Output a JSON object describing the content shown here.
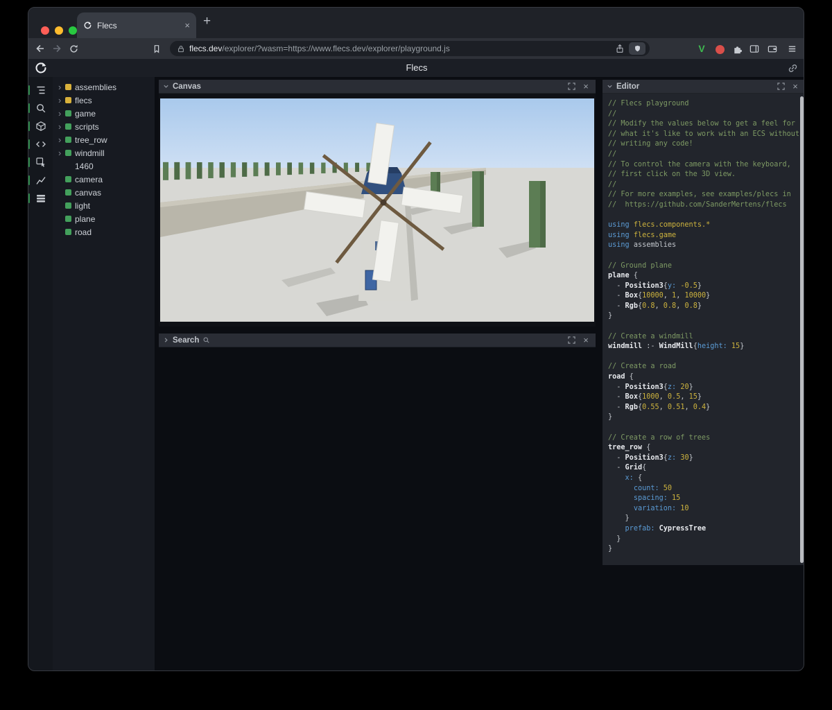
{
  "browser": {
    "traffic_lights": {
      "close": "#ff5f57",
      "minimize": "#febc2e",
      "maximize": "#28c840"
    },
    "tab": {
      "title": "Flecs",
      "close_label": "×",
      "new_tab_label": "+"
    },
    "address": {
      "domain": "flecs.dev",
      "path": "/explorer/?wasm=https://www.flecs.dev/explorer/playground.js"
    },
    "extensions": {
      "v_label": "V"
    }
  },
  "app": {
    "title": "Flecs",
    "sidebar_icons": [
      {
        "name": "tree-icon"
      },
      {
        "name": "search-icon"
      },
      {
        "name": "entities-icon"
      },
      {
        "name": "code-icon"
      },
      {
        "name": "inspector-icon"
      },
      {
        "name": "stats-icon"
      },
      {
        "name": "memory-icon"
      }
    ],
    "tree": {
      "expand_glyph": "›",
      "items": [
        {
          "label": "assemblies",
          "color": "#d9b13b",
          "expandable": true
        },
        {
          "label": "flecs",
          "color": "#d9b13b",
          "expandable": true
        },
        {
          "label": "game",
          "color": "#43a05c",
          "expandable": true
        },
        {
          "label": "scripts",
          "color": "#43a05c",
          "expandable": true
        },
        {
          "label": "tree_row",
          "color": "#43a05c",
          "expandable": true
        },
        {
          "label": "windmill",
          "color": "#43a05c",
          "expandable": true
        },
        {
          "label": "1460",
          "color": null,
          "expandable": false
        },
        {
          "label": "camera",
          "color": "#43a05c",
          "expandable": false
        },
        {
          "label": "canvas",
          "color": "#43a05c",
          "expandable": false
        },
        {
          "label": "light",
          "color": "#43a05c",
          "expandable": false
        },
        {
          "label": "plane",
          "color": "#43a05c",
          "expandable": false
        },
        {
          "label": "road",
          "color": "#43a05c",
          "expandable": false
        }
      ]
    },
    "panels": {
      "close_label": "×",
      "canvas": {
        "title": "Canvas"
      },
      "search": {
        "title": "Search"
      },
      "editor": {
        "title": "Editor"
      }
    },
    "editor": {
      "colors": {
        "comment": "#7e9a64",
        "keyword": "#5b9bd5",
        "module": "#cdb33e",
        "type": "#e8eaee",
        "property": "#5b9bd5",
        "number": "#cdb33e",
        "default": "#c3c7cd"
      },
      "lines": [
        [
          [
            "c",
            "// Flecs playground"
          ]
        ],
        [
          [
            "c",
            "//"
          ]
        ],
        [
          [
            "c",
            "// Modify the values below to get a feel for"
          ]
        ],
        [
          [
            "c",
            "// what it's like to work with an ECS without"
          ]
        ],
        [
          [
            "c",
            "// writing any code!"
          ]
        ],
        [
          [
            "c",
            "//"
          ]
        ],
        [
          [
            "c",
            "// To control the camera with the keyboard,"
          ]
        ],
        [
          [
            "c",
            "// first click on the 3D view."
          ]
        ],
        [
          [
            "c",
            "//"
          ]
        ],
        [
          [
            "c",
            "// For more examples, see examples/plecs in"
          ]
        ],
        [
          [
            "c",
            "//  https://github.com/SanderMertens/flecs"
          ]
        ],
        [],
        [
          [
            "k",
            "using "
          ],
          [
            "m",
            "flecs.components.*"
          ]
        ],
        [
          [
            "k",
            "using "
          ],
          [
            "m",
            "flecs.game"
          ]
        ],
        [
          [
            "k",
            "using "
          ],
          [
            "d",
            "assemblies"
          ]
        ],
        [],
        [
          [
            "c",
            "// Ground plane"
          ]
        ],
        [
          [
            "t",
            "plane"
          ],
          [
            "d",
            " {"
          ]
        ],
        [
          [
            "d",
            "  - "
          ],
          [
            "t",
            "Position3"
          ],
          [
            "d",
            "{"
          ],
          [
            "p",
            "y:"
          ],
          [
            "d",
            " "
          ],
          [
            "n",
            "-0.5"
          ],
          [
            "d",
            "}"
          ]
        ],
        [
          [
            "d",
            "  - "
          ],
          [
            "t",
            "Box"
          ],
          [
            "d",
            "{"
          ],
          [
            "n",
            "10000"
          ],
          [
            "d",
            ", "
          ],
          [
            "n",
            "1"
          ],
          [
            "d",
            ", "
          ],
          [
            "n",
            "10000"
          ],
          [
            "d",
            "}"
          ]
        ],
        [
          [
            "d",
            "  - "
          ],
          [
            "t",
            "Rgb"
          ],
          [
            "d",
            "{"
          ],
          [
            "n",
            "0.8"
          ],
          [
            "d",
            ", "
          ],
          [
            "n",
            "0.8"
          ],
          [
            "d",
            ", "
          ],
          [
            "n",
            "0.8"
          ],
          [
            "d",
            "}"
          ]
        ],
        [
          [
            "d",
            "}"
          ]
        ],
        [],
        [
          [
            "c",
            "// Create a windmill"
          ]
        ],
        [
          [
            "t",
            "windmill"
          ],
          [
            "d",
            " :- "
          ],
          [
            "t",
            "WindMill"
          ],
          [
            "d",
            "{"
          ],
          [
            "p",
            "height:"
          ],
          [
            "d",
            " "
          ],
          [
            "n",
            "15"
          ],
          [
            "d",
            "}"
          ]
        ],
        [],
        [
          [
            "c",
            "// Create a road"
          ]
        ],
        [
          [
            "t",
            "road"
          ],
          [
            "d",
            " {"
          ]
        ],
        [
          [
            "d",
            "  - "
          ],
          [
            "t",
            "Position3"
          ],
          [
            "d",
            "{"
          ],
          [
            "p",
            "z:"
          ],
          [
            "d",
            " "
          ],
          [
            "n",
            "20"
          ],
          [
            "d",
            "}"
          ]
        ],
        [
          [
            "d",
            "  - "
          ],
          [
            "t",
            "Box"
          ],
          [
            "d",
            "{"
          ],
          [
            "n",
            "1000"
          ],
          [
            "d",
            ", "
          ],
          [
            "n",
            "0.5"
          ],
          [
            "d",
            ", "
          ],
          [
            "n",
            "15"
          ],
          [
            "d",
            "}"
          ]
        ],
        [
          [
            "d",
            "  - "
          ],
          [
            "t",
            "Rgb"
          ],
          [
            "d",
            "{"
          ],
          [
            "n",
            "0.55"
          ],
          [
            "d",
            ", "
          ],
          [
            "n",
            "0.51"
          ],
          [
            "d",
            ", "
          ],
          [
            "n",
            "0.4"
          ],
          [
            "d",
            "}"
          ]
        ],
        [
          [
            "d",
            "}"
          ]
        ],
        [],
        [
          [
            "c",
            "// Create a row of trees"
          ]
        ],
        [
          [
            "t",
            "tree_row"
          ],
          [
            "d",
            " {"
          ]
        ],
        [
          [
            "d",
            "  - "
          ],
          [
            "t",
            "Position3"
          ],
          [
            "d",
            "{"
          ],
          [
            "p",
            "z:"
          ],
          [
            "d",
            " "
          ],
          [
            "n",
            "30"
          ],
          [
            "d",
            "}"
          ]
        ],
        [
          [
            "d",
            "  - "
          ],
          [
            "t",
            "Grid"
          ],
          [
            "d",
            "{"
          ]
        ],
        [
          [
            "d",
            "    "
          ],
          [
            "p",
            "x:"
          ],
          [
            "d",
            " {"
          ]
        ],
        [
          [
            "d",
            "      "
          ],
          [
            "p",
            "count:"
          ],
          [
            "d",
            " "
          ],
          [
            "n",
            "50"
          ]
        ],
        [
          [
            "d",
            "      "
          ],
          [
            "p",
            "spacing:"
          ],
          [
            "d",
            " "
          ],
          [
            "n",
            "15"
          ]
        ],
        [
          [
            "d",
            "      "
          ],
          [
            "p",
            "variation:"
          ],
          [
            "d",
            " "
          ],
          [
            "n",
            "10"
          ]
        ],
        [
          [
            "d",
            "    }"
          ]
        ],
        [
          [
            "d",
            "    "
          ],
          [
            "p",
            "prefab:"
          ],
          [
            "d",
            " "
          ],
          [
            "t",
            "CypressTree"
          ]
        ],
        [
          [
            "d",
            "  }"
          ]
        ],
        [
          [
            "d",
            "}"
          ]
        ]
      ]
    }
  },
  "scene": {
    "sky_color": "#b7d1ee",
    "ground_color": "#d8d8d4",
    "road_color": "#b9b6aa",
    "road_edge_color": "#cbc8bc",
    "tree_color": "#5c7d54",
    "tree_color_dark": "#4e6b47",
    "shadow_color": "#bcbcb7",
    "windmill_body": "#d8d8d3",
    "windmill_cap": "#31507f",
    "windmill_blades": "#f2f2ee",
    "windmill_beams": "#6e5a40"
  }
}
